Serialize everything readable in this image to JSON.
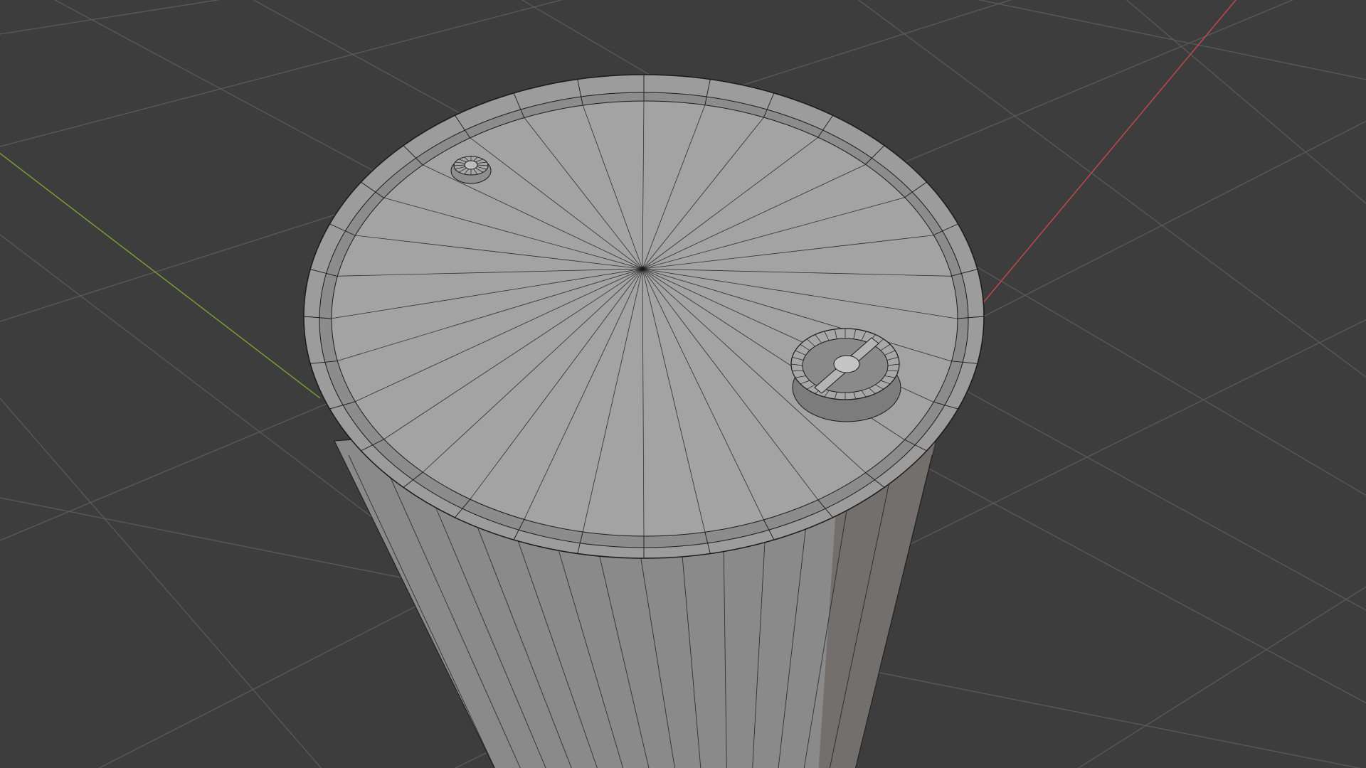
{
  "viewport": {
    "background_color": "#3d3d3d",
    "grid_color": "#5a5a5a",
    "x_axis_color": "#c8484f",
    "y_axis_color": "#7ea333",
    "mesh_color": "#a3a3a3",
    "wire_color": "#1a1a1a"
  },
  "scene": {
    "object": "barrel-mesh",
    "mode": "wireframe-overlay",
    "cap_segments": 32,
    "features": [
      "small-vent-cap",
      "bung-cap"
    ]
  }
}
